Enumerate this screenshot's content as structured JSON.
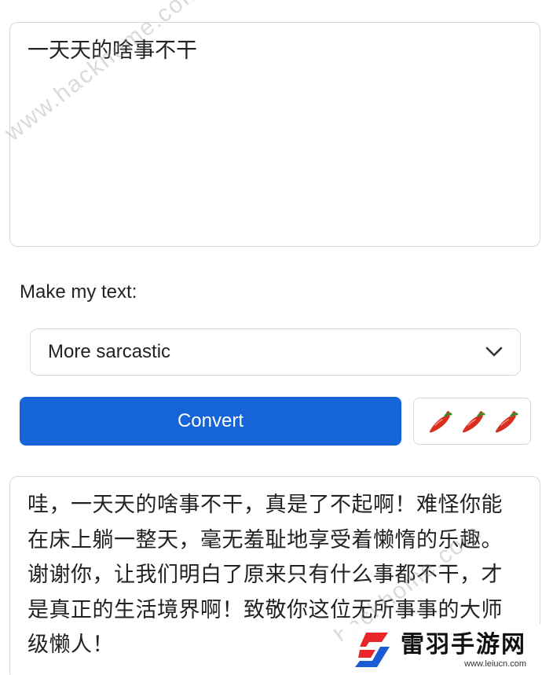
{
  "input": {
    "text": "一天天的啥事不干"
  },
  "form": {
    "make_label": "Make my text:",
    "style_selected": "More sarcastic",
    "convert_label": "Convert",
    "intensity_peppers": 3,
    "intensity_icon": "chili-pepper-icon"
  },
  "output": {
    "text": "哇，一天天的啥事不干，真是了不起啊！难怪你能在床上躺一整天，毫无羞耻地享受着懒惰的乐趣。谢谢你，让我们明白了原来只有什么事都不干，才是真正的生活境界啊！致敬你这位无所事事的大师级懒人！"
  },
  "watermarks": {
    "primary": "www.hackhome.com",
    "secondary": "hackhome.com"
  },
  "brand": {
    "name": "雷羽手游网",
    "url": "www.leiucn.com"
  },
  "colors": {
    "accent": "#1565d8",
    "pepper": "#d62f1f",
    "logo_red": "#e8262a",
    "logo_blue": "#1a5bd6"
  }
}
